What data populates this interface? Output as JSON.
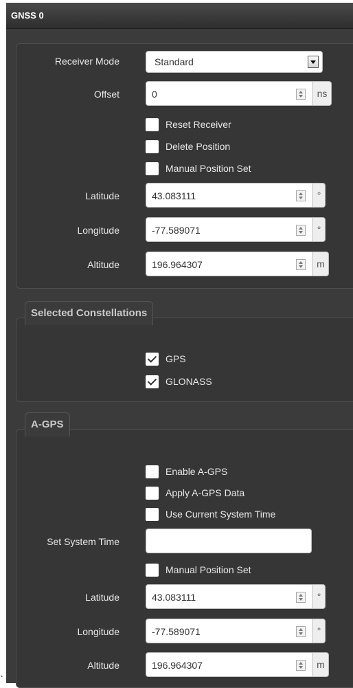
{
  "header": {
    "title": "GNSS 0"
  },
  "receiver": {
    "mode_label": "Receiver Mode",
    "mode_value": "Standard",
    "offset_label": "Offset",
    "offset_value": "0",
    "offset_unit": "ns",
    "reset_receiver": {
      "label": "Reset Receiver",
      "checked": false
    },
    "delete_position": {
      "label": "Delete Position",
      "checked": false
    },
    "manual_position_set": {
      "label": "Manual Position Set",
      "checked": false
    },
    "latitude_label": "Latitude",
    "latitude_value": "43.083111",
    "latitude_unit": "°",
    "longitude_label": "Longitude",
    "longitude_value": "-77.589071",
    "longitude_unit": "°",
    "altitude_label": "Altitude",
    "altitude_value": "196.964307",
    "altitude_unit": "m"
  },
  "constellations": {
    "legend": "Selected Constellations",
    "gps": {
      "label": "GPS",
      "checked": true
    },
    "glonass": {
      "label": "GLONASS",
      "checked": true
    }
  },
  "agps": {
    "legend": "A-GPS",
    "enable": {
      "label": "Enable A-GPS",
      "checked": false
    },
    "apply": {
      "label": "Apply A-GPS Data",
      "checked": false
    },
    "use_current_time": {
      "label": "Use Current System Time",
      "checked": false
    },
    "set_system_time_label": "Set System Time",
    "set_system_time_value": "",
    "manual_position_set": {
      "label": "Manual Position Set",
      "checked": false
    },
    "latitude_label": "Latitude",
    "latitude_value": "43.083111",
    "latitude_unit": "°",
    "longitude_label": "Longitude",
    "longitude_value": "-77.589071",
    "longitude_unit": "°",
    "altitude_label": "Altitude",
    "altitude_value": "196.964307",
    "altitude_unit": "m"
  },
  "stray_mark": "`"
}
